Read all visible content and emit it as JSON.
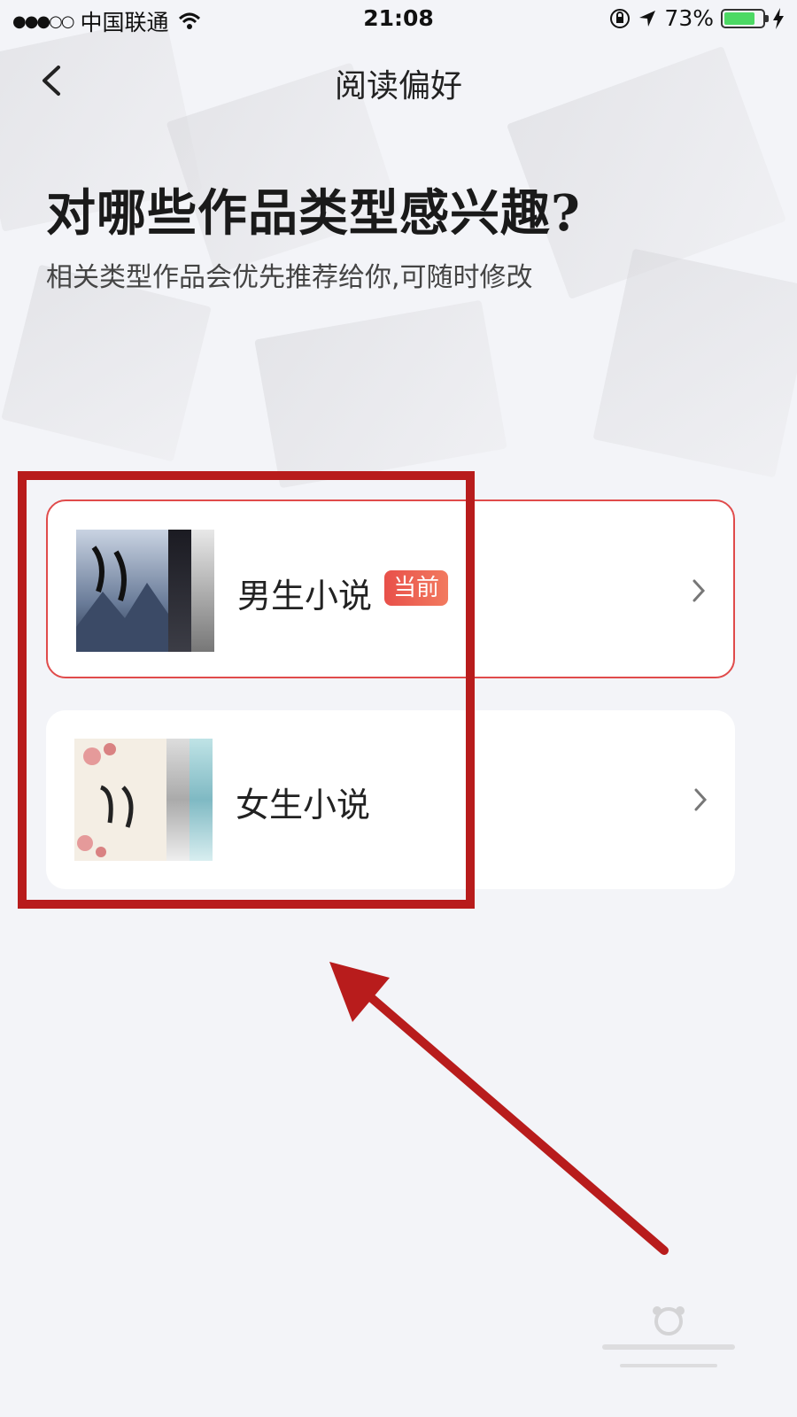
{
  "status_bar": {
    "signal": "●●●○○",
    "carrier": "中国联通",
    "time": "21:08",
    "battery": "73%"
  },
  "nav": {
    "back_icon": "chevron-left-icon",
    "title": "阅读偏好"
  },
  "heading": {
    "title": "对哪些作品类型感兴趣?",
    "subtitle": "相关类型作品会优先推荐给你,可随时修改"
  },
  "options": [
    {
      "label": "男生小说",
      "badge": "当前",
      "selected": true
    },
    {
      "label": "女生小说",
      "selected": false
    }
  ],
  "colors": {
    "accent_red": "#e04b4b",
    "annotation_red": "#b81c1c",
    "background": "#f3f4f8"
  }
}
